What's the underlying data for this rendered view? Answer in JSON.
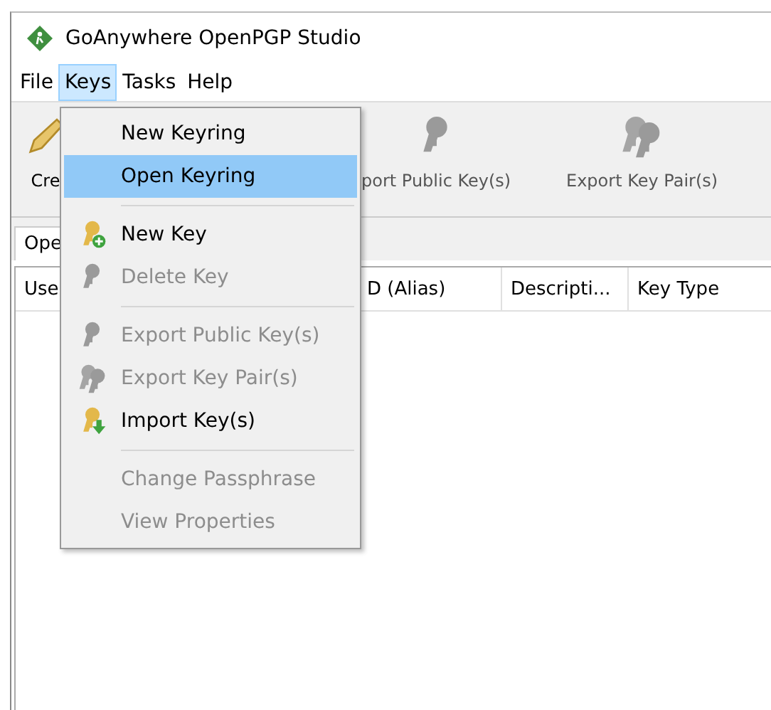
{
  "window": {
    "title": "GoAnywhere OpenPGP Studio"
  },
  "menu_bar": [
    {
      "label": "File",
      "selected": false
    },
    {
      "label": "Keys",
      "selected": true
    },
    {
      "label": "Tasks",
      "selected": false
    },
    {
      "label": "Help",
      "selected": false
    }
  ],
  "toolbar": [
    {
      "label": "Cre"
    },
    {
      "label": "port Public Key(s)"
    },
    {
      "label": "Export Key Pair(s)"
    }
  ],
  "tabs": [
    {
      "label": "Ope",
      "selected": true
    }
  ],
  "table": {
    "columns": [
      "Use",
      "D (Alias)",
      "Descripti...",
      "Key Type"
    ]
  },
  "keys_menu": [
    {
      "kind": "item",
      "label": "New Keyring",
      "disabled": false,
      "selected": false
    },
    {
      "kind": "item",
      "label": "Open Keyring",
      "disabled": false,
      "selected": true
    },
    {
      "kind": "separator"
    },
    {
      "kind": "item",
      "label": "New Key",
      "disabled": false,
      "selected": false
    },
    {
      "kind": "item",
      "label": "Delete Key",
      "disabled": true,
      "selected": false
    },
    {
      "kind": "separator"
    },
    {
      "kind": "item",
      "label": "Export Public Key(s)",
      "disabled": true,
      "selected": false
    },
    {
      "kind": "item",
      "label": "Export Key Pair(s)",
      "disabled": true,
      "selected": false
    },
    {
      "kind": "item",
      "label": "Import Key(s)",
      "disabled": false,
      "selected": false
    },
    {
      "kind": "separator"
    },
    {
      "kind": "item",
      "label": "Change Passphrase",
      "disabled": true,
      "selected": false
    },
    {
      "kind": "item",
      "label": "View Properties",
      "disabled": true,
      "selected": false
    }
  ]
}
